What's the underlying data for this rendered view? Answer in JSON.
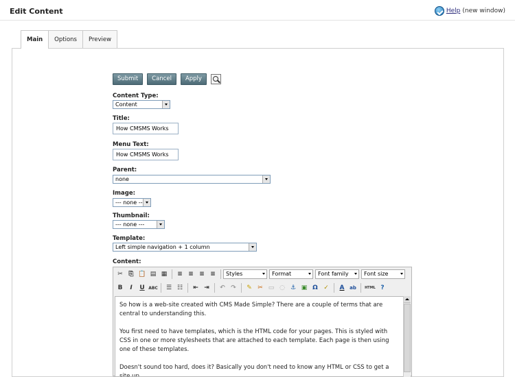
{
  "header": {
    "title": "Edit Content",
    "help_link": "Help",
    "help_suffix": "(new window)"
  },
  "tabs": [
    {
      "label": "Main",
      "active": true
    },
    {
      "label": "Options",
      "active": false
    },
    {
      "label": "Preview",
      "active": false
    }
  ],
  "buttons": {
    "submit": "Submit",
    "cancel": "Cancel",
    "apply": "Apply"
  },
  "fields": {
    "content_type": {
      "label": "Content Type:",
      "value": "Content"
    },
    "title": {
      "label": "Title:",
      "value": "How CMSMS Works"
    },
    "menu_text": {
      "label": "Menu Text:",
      "value": "How CMSMS Works"
    },
    "parent": {
      "label": "Parent:",
      "value": "none"
    },
    "image": {
      "label": "Image:",
      "value": "--- none ---"
    },
    "thumbnail": {
      "label": "Thumbnail:",
      "value": "--- none ---"
    },
    "template": {
      "label": "Template:",
      "value": "Left simple navigation + 1 column"
    },
    "content": {
      "label": "Content:"
    }
  },
  "editor": {
    "styles": "Styles",
    "format": "Format",
    "font_family": "Font family",
    "font_size": "Font size",
    "paragraphs": [
      "So how is a web-site created with CMS Made Simple? There are a couple of terms that are central to understanding this.",
      "You first need to have templates, which is the HTML code for your pages. This is styled with CSS in one or more stylesheets that are attached to each template. Each page is then using one of these templates.",
      "Doesn't sound too hard, does it? Basically you don't need to know any HTML or CSS to get a site up"
    ]
  }
}
